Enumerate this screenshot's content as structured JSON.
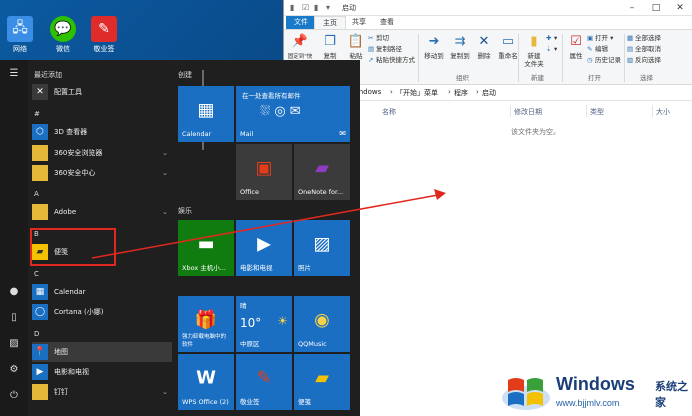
{
  "desktop": {
    "icons": [
      {
        "label": "网络",
        "icon": "network-icon"
      },
      {
        "label": "微信",
        "icon": "wechat-icon"
      },
      {
        "label": "敬业签",
        "icon": "jingyeqian-icon"
      }
    ]
  },
  "start_menu": {
    "recent_header": "最近添加",
    "apps": [
      {
        "label": "配置工具",
        "icon": "tool-icon"
      },
      {
        "label": "#",
        "header": true
      },
      {
        "label": "3D 查看器",
        "icon": "3d-icon"
      },
      {
        "label": "360安全浏览器",
        "icon": "folder-icon",
        "expand": true
      },
      {
        "label": "360安全中心",
        "icon": "folder-icon",
        "expand": true
      },
      {
        "label": "A",
        "header": true
      },
      {
        "label": "Adobe",
        "icon": "folder-icon",
        "expand": true
      },
      {
        "label": "B",
        "header": true
      },
      {
        "label": "便笺",
        "icon": "sticky-notes-icon"
      },
      {
        "label": "C",
        "header": true
      },
      {
        "label": "Calendar",
        "icon": "calendar-icon"
      },
      {
        "label": "Cortana (小娜)",
        "icon": "cortana-icon"
      },
      {
        "label": "D",
        "header": true
      },
      {
        "label": "地图",
        "icon": "map-icon"
      },
      {
        "label": "电影和电视",
        "icon": "movies-icon"
      },
      {
        "label": "钉钉",
        "icon": "folder-icon",
        "expand": true
      }
    ],
    "groups": {
      "create": "创建",
      "entertainment": "娱乐"
    },
    "tiles": {
      "calendar": "Calendar",
      "mail_banner": "在一处查看所有邮件",
      "mail": "Mail",
      "office": "Office",
      "onenote": "OneNote for...",
      "xbox": "Xbox 主机小...",
      "movies": "电影和电视",
      "photos": "照片",
      "game": "强力卸载电脑中的软件",
      "weather_header": "晴",
      "weather_temp": "10°",
      "weather_city": "中原区",
      "qqmusic": "QQMusic",
      "wps": "WPS Office (2)",
      "jingyeqian": "敬业签",
      "notes": "便笺"
    }
  },
  "explorer": {
    "title": "启动",
    "tabs": [
      "文件",
      "主页",
      "共享",
      "查看"
    ],
    "ribbon": {
      "pin_label": "固定到\"快速访问\"",
      "copy_label": "复制",
      "paste_label": "粘贴",
      "cut": "剪切",
      "copy_path": "复制路径",
      "paste_shortcut": "粘贴快捷方式",
      "move_to": "移动到",
      "copy_to": "复制到",
      "delete": "删除",
      "rename": "重命名",
      "new_folder": "新建\n文件夹",
      "properties": "属性",
      "open": "打开",
      "edit": "编辑",
      "history": "历史记录",
      "select_all": "全部选择",
      "select_none": "全部取消",
      "invert": "反向选择",
      "group_organize": "组织",
      "group_new": "新建",
      "group_open": "打开",
      "group_select": "选择"
    },
    "breadcrumbs": [
      "Windows",
      "「开始」菜单",
      "程序",
      "启动"
    ],
    "columns": [
      "名称",
      "修改日期",
      "类型",
      "大小"
    ],
    "empty_text": "该文件夹为空。"
  },
  "watermark": {
    "brand": "Windows",
    "site_cn": "系统之家",
    "url": "www.bjjmlv.com"
  },
  "colors": {
    "accent": "#1b6fc2",
    "annotation": "#e0281f"
  }
}
